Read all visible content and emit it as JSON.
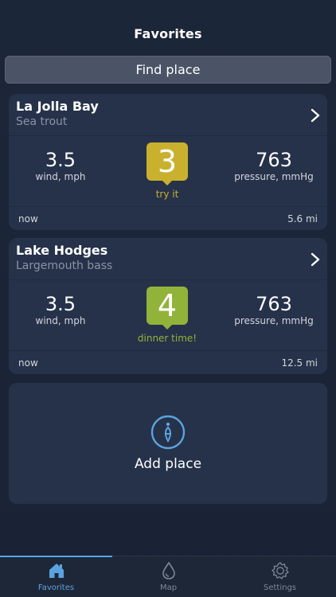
{
  "header": {
    "title": "Favorites"
  },
  "find_place": {
    "label": "Find place"
  },
  "cards": [
    {
      "place": "La Jolla Bay",
      "fish": "Sea trout",
      "wind_value": "3.5",
      "wind_label": "wind, mph",
      "rating": "3",
      "rating_text": "try it",
      "rating_color": "#c9b12d",
      "pressure_value": "763",
      "pressure_label": "pressure, mmHg",
      "time": "now",
      "distance": "5.6 mi"
    },
    {
      "place": "Lake Hodges",
      "fish": "Largemouth bass",
      "wind_value": "3.5",
      "wind_label": "wind, mph",
      "rating": "4",
      "rating_text": "dinner time!",
      "rating_color": "#92b33a",
      "pressure_value": "763",
      "pressure_label": "pressure, mmHg",
      "time": "now",
      "distance": "12.5 mi"
    }
  ],
  "add_place": {
    "label": "Add place",
    "icon": "float-icon"
  },
  "tabs": [
    {
      "label": "Favorites",
      "icon": "home-icon",
      "active": true
    },
    {
      "label": "Map",
      "icon": "drop-icon",
      "active": false
    },
    {
      "label": "Settings",
      "icon": "gear-icon",
      "active": false
    }
  ],
  "colors": {
    "accent": "#5aa3e0",
    "background": "#1b2538",
    "card": "#26324a"
  }
}
